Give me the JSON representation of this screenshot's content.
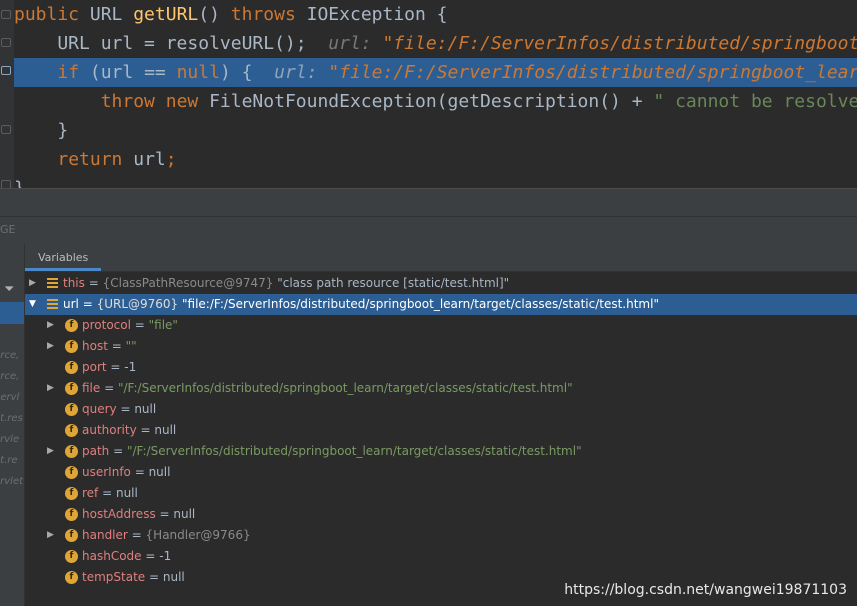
{
  "editor": {
    "lines": [
      {
        "kw1": "public",
        "t1": " URL ",
        "fn": "getURL",
        "t2": "() ",
        "kw2": "throws",
        "t3": " IOException {"
      },
      {
        "t1": "    URL url = resolveURL();  ",
        "lbl": "url: ",
        "val": "\"file:/F:/ServerInfos/distributed/springboot_learn/"
      },
      {
        "t1": "    ",
        "kw1": "if",
        "t2": " (url == ",
        "kw2": "null",
        "t3": ") {  ",
        "lbl": "url: ",
        "val": "\"file:/F:/ServerInfos/distributed/springboot_learn/"
      },
      {
        "t1": "        ",
        "kw1": "throw",
        "t2": " ",
        "kw2": "new",
        "t3": " FileNotFoundException(getDescription() + ",
        "str": "\" cannot be resolved to URL\""
      },
      {
        "t1": "    }"
      },
      {
        "t1": "    ",
        "kw1": "return",
        "t2": " url",
        "kw2": ";"
      },
      {
        "t1": "}"
      }
    ]
  },
  "debug": {
    "strip_fragment": "GE",
    "tab_label": "Variables",
    "frames_fragments": [
      "urce,",
      "urce,",
      "Servl",
      "et.res",
      "ervle",
      "et.re",
      "ervlet"
    ],
    "filter_icon": "filter-icon"
  },
  "variables": {
    "this_row": {
      "name": "this",
      "type": "{ClassPathResource@9747}",
      "value": "\"class path resource [static/test.html]\""
    },
    "url_row": {
      "name": "url",
      "type": "{URL@9760}",
      "value": "\"file:/F:/ServerInfos/distributed/springboot_learn/target/classes/static/test.html\""
    },
    "fields": [
      {
        "name": "protocol",
        "value": "\"file\"",
        "kind": "str",
        "expandable": true
      },
      {
        "name": "host",
        "value": "\"\"",
        "kind": "str",
        "expandable": true
      },
      {
        "name": "port",
        "value": "-1",
        "kind": "plain",
        "expandable": false
      },
      {
        "name": "file",
        "value": "\"/F:/ServerInfos/distributed/springboot_learn/target/classes/static/test.html\"",
        "kind": "str",
        "expandable": true
      },
      {
        "name": "query",
        "value": "null",
        "kind": "plain",
        "expandable": false
      },
      {
        "name": "authority",
        "value": "null",
        "kind": "plain",
        "expandable": false
      },
      {
        "name": "path",
        "value": "\"/F:/ServerInfos/distributed/springboot_learn/target/classes/static/test.html\"",
        "kind": "str",
        "expandable": true
      },
      {
        "name": "userInfo",
        "value": "null",
        "kind": "plain",
        "expandable": false
      },
      {
        "name": "ref",
        "value": "null",
        "kind": "plain",
        "expandable": false
      },
      {
        "name": "hostAddress",
        "value": "null",
        "kind": "plain",
        "expandable": false
      },
      {
        "name": "handler",
        "value": "{Handler@9766}",
        "kind": "type",
        "expandable": true
      },
      {
        "name": "hashCode",
        "value": "-1",
        "kind": "plain",
        "expandable": false
      },
      {
        "name": "tempState",
        "value": "null",
        "kind": "plain",
        "expandable": false
      }
    ]
  },
  "watermark": "https://blog.csdn.net/wangwei19871103",
  "colors": {
    "keyword": "#cc7832",
    "function": "#ffc66d",
    "string": "#6a8759",
    "selection": "#2d5e93",
    "field_icon": "#dfa637"
  }
}
